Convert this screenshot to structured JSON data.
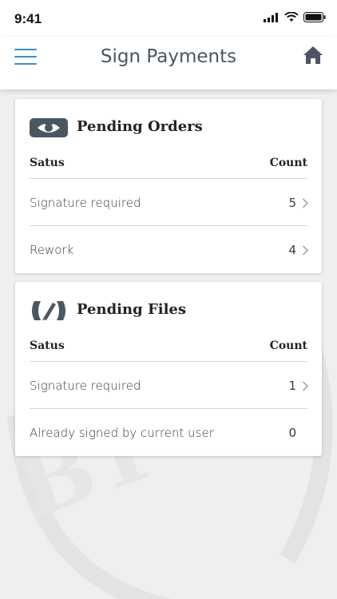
{
  "status_bar": {
    "time": "9:41"
  },
  "navbar": {
    "title": "Sign Payments",
    "menu_icon": "hamburger-menu-icon",
    "home_icon": "home-icon"
  },
  "colors": {
    "accent": "#3a8fc4",
    "icon_dark": "#4a5663",
    "background": "#efefef",
    "card": "#ffffff"
  },
  "orders": {
    "title": "Pending Orders",
    "icon": "eye-icon",
    "col_status": "Satus",
    "col_count": "Count",
    "rows": [
      {
        "label": "Signature required",
        "count": "5"
      },
      {
        "label": "Rework",
        "count": "4"
      }
    ]
  },
  "files": {
    "title": "Pending Files",
    "icon": "pen-icon",
    "col_status": "Satus",
    "col_count": "Count",
    "rows": [
      {
        "label": "Signature required",
        "count": "1"
      },
      {
        "label": "Already signed by current user",
        "count": "0"
      }
    ]
  },
  "watermark_text": "BT"
}
